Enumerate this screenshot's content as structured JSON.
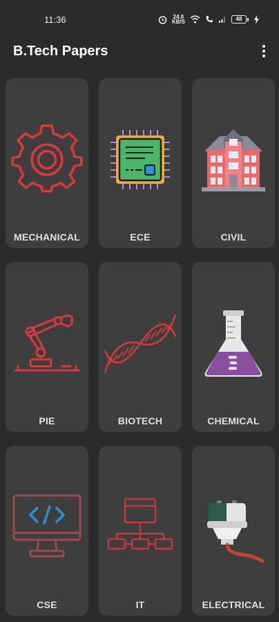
{
  "status_bar": {
    "time": "11:36",
    "net_speed_value": "24.0",
    "net_speed_unit": "KB/S",
    "battery": "48"
  },
  "app_bar": {
    "title": "B.Tech Papers"
  },
  "branches": [
    {
      "label": "MECHANICAL",
      "icon": "gear-icon"
    },
    {
      "label": "ECE",
      "icon": "microchip-icon"
    },
    {
      "label": "CIVIL",
      "icon": "building-icon"
    },
    {
      "label": "PIE",
      "icon": "robotic-arm-icon"
    },
    {
      "label": "BIOTECH",
      "icon": "dna-icon"
    },
    {
      "label": "CHEMICAL",
      "icon": "flask-icon"
    },
    {
      "label": "CSE",
      "icon": "monitor-code-icon"
    },
    {
      "label": "IT",
      "icon": "network-icon"
    },
    {
      "label": "ELECTRICAL",
      "icon": "power-plug-icon"
    }
  ],
  "colors": {
    "background": "#2b2b2b",
    "card": "#3e3e3e",
    "icon_red": "#d63a3a",
    "chip_green": "#4db56a",
    "flask_purple": "#8a4f9e"
  }
}
